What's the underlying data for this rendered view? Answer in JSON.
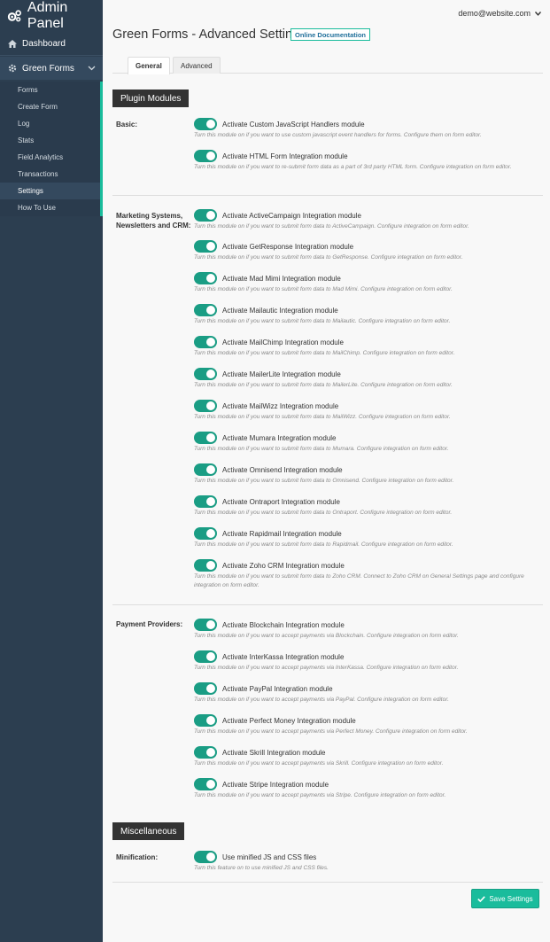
{
  "sidebar": {
    "brand": "Admin Panel",
    "dashboard": "Dashboard",
    "plugin": "Green Forms",
    "items": [
      "Forms",
      "Create Form",
      "Log",
      "Stats",
      "Field Analytics",
      "Transactions",
      "Settings",
      "How To Use"
    ],
    "active_item": "Settings"
  },
  "header": {
    "user": "demo@website.com",
    "title": "Green Forms - Advanced Settings",
    "doc_button": "Online Documentation",
    "tabs": [
      {
        "label": "General",
        "active": true
      },
      {
        "label": "Advanced",
        "active": false
      }
    ]
  },
  "sections": {
    "plugin_modules": "Plugin Modules",
    "miscellaneous": "Miscellaneous"
  },
  "groups": [
    {
      "label": "Basic:",
      "items": [
        {
          "label": "Activate Custom JavaScript Handlers module",
          "hint": "Turn this module on if you want to use custom javascript event handlers for forms. Configure them on form editor."
        },
        {
          "label": "Activate HTML Form Integration module",
          "hint": "Turn this module on if you want to re-submit form data as a part of 3rd party HTML form. Configure integration on form editor."
        }
      ]
    },
    {
      "label": "Marketing Systems, Newsletters and CRM:",
      "items": [
        {
          "label": "Activate ActiveCampaign Integration module",
          "hint": "Turn this module on if you want to submit form data to ActiveCampaign. Configure integration on form editor."
        },
        {
          "label": "Activate GetResponse Integration module",
          "hint": "Turn this module on if you want to submit form data to GetResponse. Configure integration on form editor."
        },
        {
          "label": "Activate Mad Mimi Integration module",
          "hint": "Turn this module on if you want to submit form data to Mad Mimi. Configure integration on form editor."
        },
        {
          "label": "Activate Mailautic Integration module",
          "hint": "Turn this module on if you want to submit form data to Mailautic. Configure integration on form editor."
        },
        {
          "label": "Activate MailChimp Integration module",
          "hint": "Turn this module on if you want to submit form data to MailChimp. Configure integration on form editor."
        },
        {
          "label": "Activate MailerLite Integration module",
          "hint": "Turn this module on if you want to submit form data to MailerLite. Configure integration on form editor."
        },
        {
          "label": "Activate MailWizz Integration module",
          "hint": "Turn this module on if you want to submit form data to MailWizz. Configure integration on form editor."
        },
        {
          "label": "Activate Mumara Integration module",
          "hint": "Turn this module on if you want to submit form data to Mumara. Configure integration on form editor."
        },
        {
          "label": "Activate Omnisend Integration module",
          "hint": "Turn this module on if you want to submit form data to Omnisend. Configure integration on form editor."
        },
        {
          "label": "Activate Ontraport Integration module",
          "hint": "Turn this module on if you want to submit form data to Ontraport. Configure integration on form editor."
        },
        {
          "label": "Activate Rapidmail Integration module",
          "hint": "Turn this module on if you want to submit form data to Rapidmail. Configure integration on form editor."
        },
        {
          "label": "Activate Zoho CRM Integration module",
          "hint": "Turn this module on if you want to submit form data to Zoho CRM. Connect to Zoho CRM on General Settings page and configure integration on form editor."
        }
      ]
    },
    {
      "label": "Payment Providers:",
      "items": [
        {
          "label": "Activate Blockchain Integration module",
          "hint": "Turn this module on if you want to accept payments via Blockchain. Configure integration on form editor."
        },
        {
          "label": "Activate InterKassa Integration module",
          "hint": "Turn this module on if you want to accept payments via InterKassa. Configure integration on form editor."
        },
        {
          "label": "Activate PayPal Integration module",
          "hint": "Turn this module on if you want to accept payments via PayPal. Configure integration on form editor."
        },
        {
          "label": "Activate Perfect Money Integration module",
          "hint": "Turn this module on if you want to accept payments via Perfect Money. Configure integration on form editor."
        },
        {
          "label": "Activate Skrill Integration module",
          "hint": "Turn this module on if you want to accept payments via Skrill. Configure integration on form editor."
        },
        {
          "label": "Activate Stripe Integration module",
          "hint": "Turn this module on if you want to accept payments via Stripe. Configure integration on form editor."
        }
      ]
    },
    {
      "label": "Minification:",
      "items": [
        {
          "label": "Use minified JS and CSS files",
          "hint": "Turn this feature on to use minified JS and CSS files."
        }
      ]
    }
  ],
  "save_button": "Save Settings",
  "colors": {
    "sidebar": "#2c3e50",
    "accent": "#1abc9c",
    "toggle_on": "#1a9d84",
    "section_head": "#333333"
  }
}
